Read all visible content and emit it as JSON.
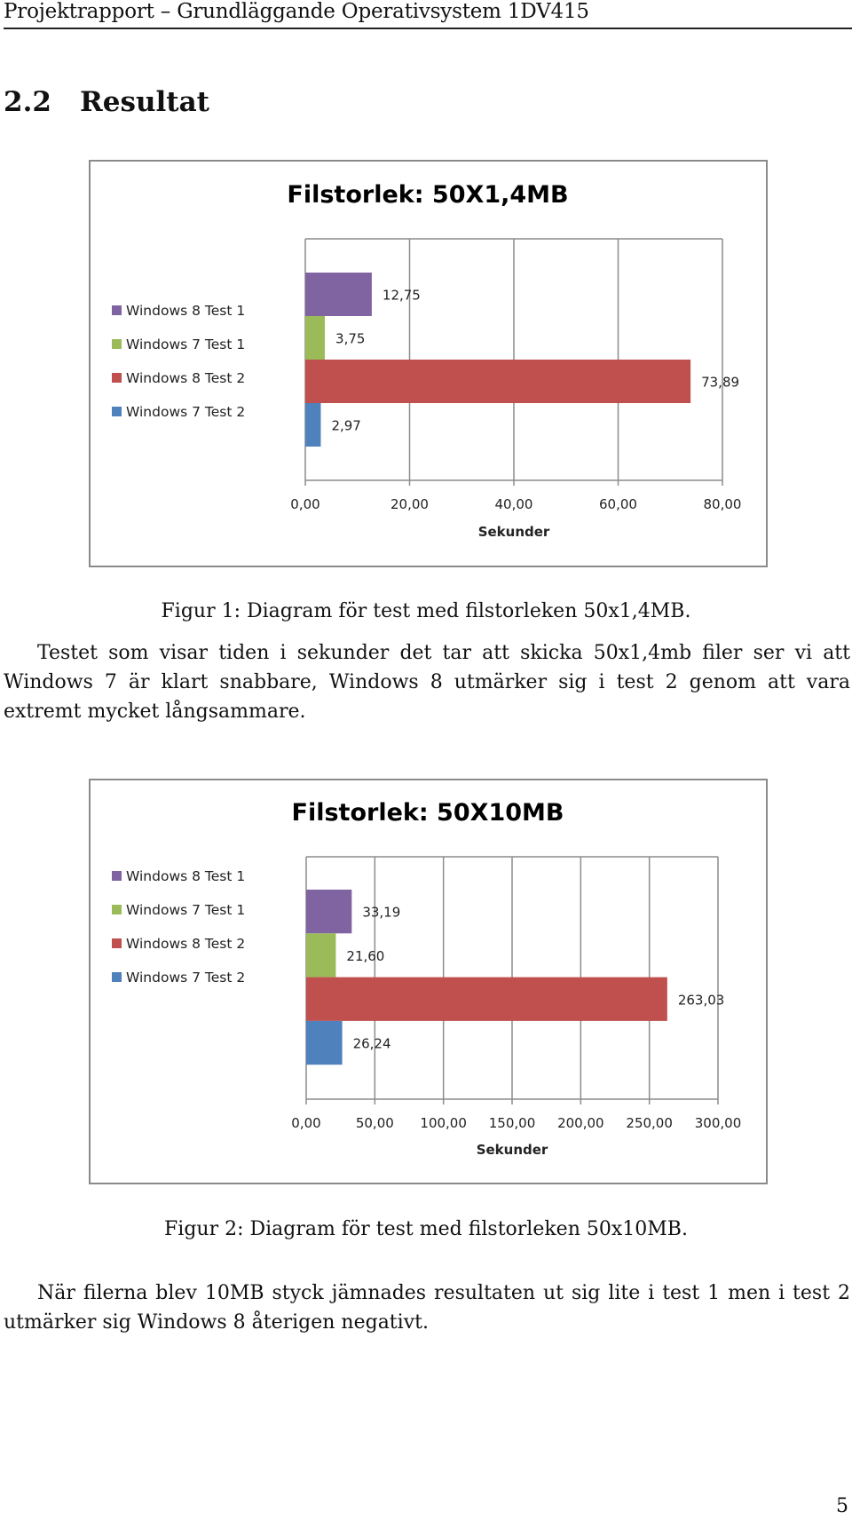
{
  "header": {
    "running_title": "Projektrapport – Grundläggande Operativsystem 1DV415"
  },
  "section": {
    "number": "2.2",
    "title": "Resultat"
  },
  "chart_data": [
    {
      "type": "bar",
      "orientation": "horizontal",
      "title": "Filstorlek: 50X1,4MB",
      "xlabel": "Sekunder",
      "ylabel": "",
      "xlim": [
        0,
        80
      ],
      "xticks": [
        "0,00",
        "20,00",
        "40,00",
        "60,00",
        "80,00"
      ],
      "xtick_values": [
        0,
        20,
        40,
        60,
        80
      ],
      "grid": true,
      "legend_position": "left",
      "series": [
        {
          "name": "Windows 8 Test 1",
          "value": 12.75,
          "label": "12,75",
          "color": "#8064a2"
        },
        {
          "name": "Windows 7 Test 1",
          "value": 3.75,
          "label": "3,75",
          "color": "#9bbb59"
        },
        {
          "name": "Windows 8 Test 2",
          "value": 73.89,
          "label": "73,89",
          "color": "#c0504d"
        },
        {
          "name": "Windows 7 Test 2",
          "value": 2.97,
          "label": "2,97",
          "color": "#4f81bd"
        }
      ]
    },
    {
      "type": "bar",
      "orientation": "horizontal",
      "title": "Filstorlek: 50X10MB",
      "xlabel": "Sekunder",
      "ylabel": "",
      "xlim": [
        0,
        300
      ],
      "xticks": [
        "0,00",
        "50,00",
        "100,00",
        "150,00",
        "200,00",
        "250,00",
        "300,00"
      ],
      "xtick_values": [
        0,
        50,
        100,
        150,
        200,
        250,
        300
      ],
      "grid": true,
      "legend_position": "left",
      "series": [
        {
          "name": "Windows 8 Test 1",
          "value": 33.19,
          "label": "33,19",
          "color": "#8064a2"
        },
        {
          "name": "Windows 7 Test 1",
          "value": 21.6,
          "label": "21,60",
          "color": "#9bbb59"
        },
        {
          "name": "Windows 8 Test 2",
          "value": 263.03,
          "label": "263,03",
          "color": "#c0504d"
        },
        {
          "name": "Windows 7 Test 2",
          "value": 26.24,
          "label": "26,24",
          "color": "#4f81bd"
        }
      ]
    }
  ],
  "figures": [
    {
      "caption": "Figur 1: Diagram för test med filstorleken 50x1,4MB."
    },
    {
      "caption": "Figur 2: Diagram för test med filstorleken 50x10MB."
    }
  ],
  "paragraphs": [
    "Testet som visar tiden i sekunder det tar att skicka 50x1,4mb filer ser vi att Windows 7 är klart snabbare, Windows 8 utmärker sig i test 2 genom att vara extremt mycket långsammare.",
    "När filerna blev 10MB styck jämnades resultaten ut sig lite i test 1 men i test 2 utmärker sig Windows 8 återigen negativt."
  ],
  "page_number": "5"
}
